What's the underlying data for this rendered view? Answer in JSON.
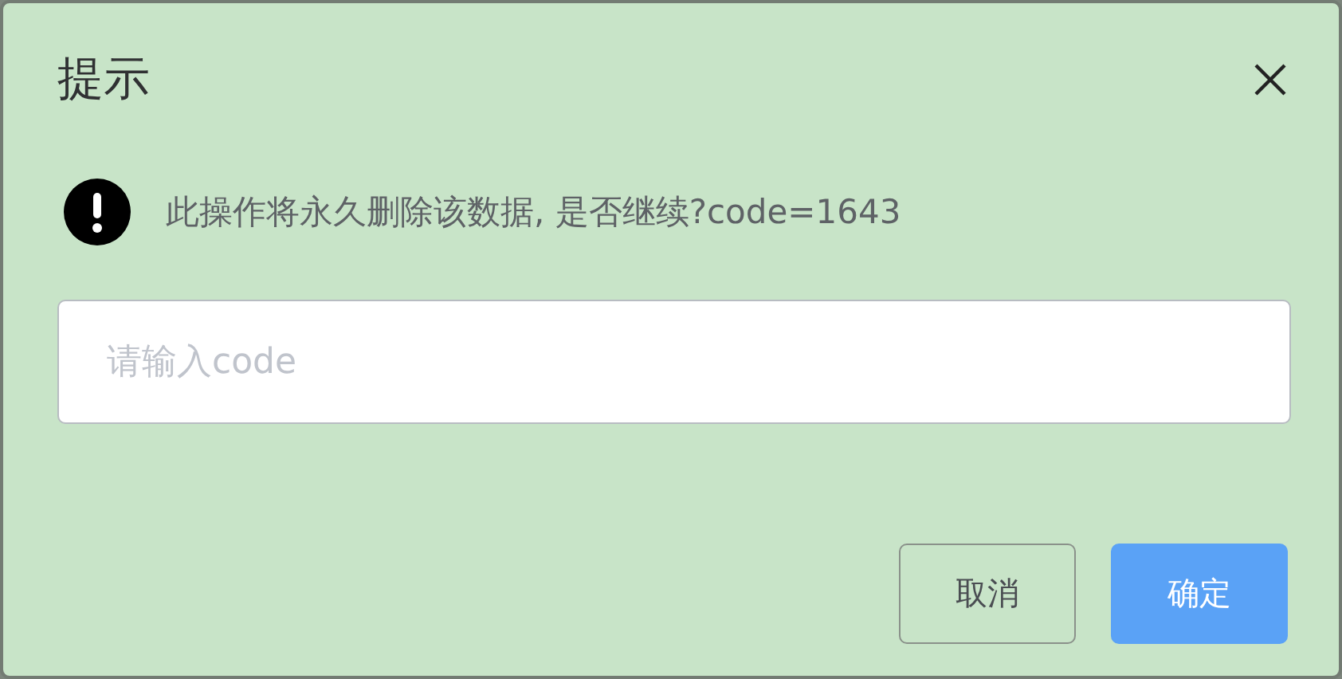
{
  "dialog": {
    "title": "提示",
    "message": "此操作将永久删除该数据, 是否继续?code=1643",
    "input": {
      "placeholder": "请输入code"
    },
    "buttons": [
      {
        "label": "取消",
        "kind": "secondary"
      },
      {
        "label": "确定",
        "kind": "primary"
      }
    ]
  }
}
